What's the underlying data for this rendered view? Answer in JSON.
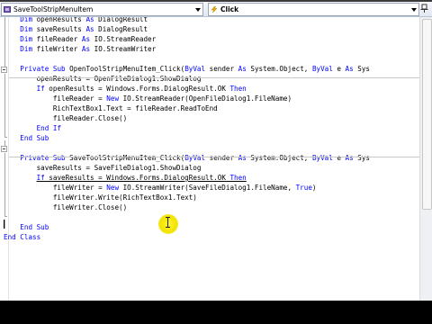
{
  "navbar": {
    "left_combo": {
      "text": "SaveToolStripMenuItem",
      "icon": "class-member-icon"
    },
    "right_combo": {
      "text": "Click",
      "icon": "lightning-event-icon"
    },
    "pin_icon": "pin-icon"
  },
  "code": [
    [
      [
        "    ",
        ""
      ],
      [
        "Dim",
        "kw"
      ],
      [
        " openResults ",
        ""
      ],
      [
        "As",
        "kw"
      ],
      [
        " DialogResult",
        ""
      ]
    ],
    [
      [
        "    ",
        ""
      ],
      [
        "Dim",
        "kw"
      ],
      [
        " saveResults ",
        ""
      ],
      [
        "As",
        "kw"
      ],
      [
        " DialogResult",
        ""
      ]
    ],
    [
      [
        "    ",
        ""
      ],
      [
        "Dim",
        "kw"
      ],
      [
        " fileReader ",
        ""
      ],
      [
        "As",
        "kw"
      ],
      [
        " IO.StreamReader",
        ""
      ]
    ],
    [
      [
        "    ",
        ""
      ],
      [
        "Dim",
        "kw"
      ],
      [
        " fileWriter ",
        ""
      ],
      [
        "As",
        "kw"
      ],
      [
        " IO.StreamWriter",
        ""
      ]
    ],
    [],
    [
      [
        "    ",
        ""
      ],
      [
        "Private",
        "kw"
      ],
      [
        " ",
        ""
      ],
      [
        "Sub",
        "kw"
      ],
      [
        " OpenToolStripMenuItem_Click(",
        ""
      ],
      [
        "ByVal",
        "kw"
      ],
      [
        " sender ",
        ""
      ],
      [
        "As",
        "kw"
      ],
      [
        " System.Object, ",
        ""
      ],
      [
        "ByVal",
        "kw"
      ],
      [
        " e ",
        ""
      ],
      [
        "As",
        "kw"
      ],
      [
        " Sys",
        ""
      ]
    ],
    [
      [
        "        openResults = OpenFileDialog1.ShowDialog",
        ""
      ]
    ],
    [
      [
        "        ",
        ""
      ],
      [
        "If",
        "kw"
      ],
      [
        " openResults = Windows.Forms.DialogResult.OK ",
        ""
      ],
      [
        "Then",
        "kw"
      ]
    ],
    [
      [
        "            fileReader = ",
        ""
      ],
      [
        "New",
        "kw"
      ],
      [
        " IO.StreamReader(OpenFileDialog1.FileName)",
        ""
      ]
    ],
    [
      [
        "            RichTextBox1.Text = fileReader.ReadToEnd",
        ""
      ]
    ],
    [
      [
        "            fileReader.Close()",
        ""
      ]
    ],
    [
      [
        "        ",
        ""
      ],
      [
        "End",
        "kw"
      ],
      [
        " ",
        ""
      ],
      [
        "If",
        "kw"
      ]
    ],
    [
      [
        "    ",
        ""
      ],
      [
        "End",
        "kw"
      ],
      [
        " ",
        ""
      ],
      [
        "Sub",
        "kw"
      ]
    ],
    [],
    [
      [
        "    ",
        ""
      ],
      [
        "Private",
        "kw"
      ],
      [
        " ",
        ""
      ],
      [
        "Sub",
        "kw"
      ],
      [
        " SaveToolStripMenuItem_Click(",
        ""
      ],
      [
        "ByVal",
        "kw"
      ],
      [
        " sender ",
        ""
      ],
      [
        "As",
        "kw"
      ],
      [
        " System.Object, ",
        ""
      ],
      [
        "ByVal",
        "kw"
      ],
      [
        " e ",
        ""
      ],
      [
        "As",
        "kw"
      ],
      [
        " Sys",
        ""
      ]
    ],
    [
      [
        "        saveResults = SaveFileDialog1.ShowDialog",
        ""
      ]
    ],
    [
      [
        "        ",
        ""
      ],
      [
        "If",
        "kw ul"
      ],
      [
        " saveResults = Windows.Forms.DialogResult.OK ",
        "ul"
      ],
      [
        "Then",
        "kw ul"
      ]
    ],
    [
      [
        "            fileWriter = ",
        ""
      ],
      [
        "New",
        "kw"
      ],
      [
        " IO.StreamWriter(SaveFileDialog1.FileName, ",
        ""
      ],
      [
        "True",
        "kw"
      ],
      [
        ")",
        ""
      ]
    ],
    [
      [
        "            fileWriter.Write(RichTextBox1.Text)",
        ""
      ]
    ],
    [
      [
        "            fileWriter.Close()",
        ""
      ]
    ],
    [],
    [
      [
        "    ",
        ""
      ],
      [
        "End",
        "kw"
      ],
      [
        " ",
        ""
      ],
      [
        "Sub",
        "kw"
      ]
    ],
    [
      [
        "",
        ""
      ],
      [
        "End",
        "kw"
      ],
      [
        " ",
        ""
      ],
      [
        "Class",
        "kw"
      ]
    ]
  ]
}
